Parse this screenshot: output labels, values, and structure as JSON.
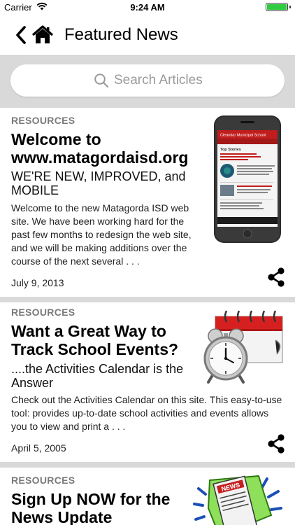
{
  "status_bar": {
    "carrier": "Carrier",
    "time": "9:24 AM",
    "battery_level": 1.0,
    "battery_color": "#2ecc40"
  },
  "nav": {
    "title": "Featured News",
    "back_icon": "chevron-left-icon",
    "home_icon": "home-icon"
  },
  "search": {
    "placeholder": "Search Articles"
  },
  "articles": [
    {
      "category": "RESOURCES",
      "title": "Welcome to www.matagordaisd.org",
      "subtitle": "WE'RE NEW, IMPROVED, and MOBILE",
      "snippet": "Welcome to the new Matagorda ISD web site. We have been working hard for the past few months to redesign the web site, and we will be making additions over the course of the next several . . .",
      "date": "July 9, 2013",
      "thumb_header": "Cleandar Municipal School",
      "thumb_section": "Top Stories"
    },
    {
      "category": "RESOURCES",
      "title": "Want a Great Way to Track School Events?",
      "subtitle": "....the Activities Calendar is the Answer",
      "snippet": "  Check out the Activities Calendar on this site.  This easy-to-use tool: provides up-to-date school activities and events allows you to view and print a . . .",
      "date": "April 5, 2005"
    },
    {
      "category": "RESOURCES",
      "title": "Sign Up NOW for the News Update",
      "thumb_label": "NEWS"
    }
  ],
  "colors": {
    "accent": "#000000",
    "separator": "#d9d9d9",
    "category": "#7a7a7a",
    "calendar_red": "#d62020"
  }
}
